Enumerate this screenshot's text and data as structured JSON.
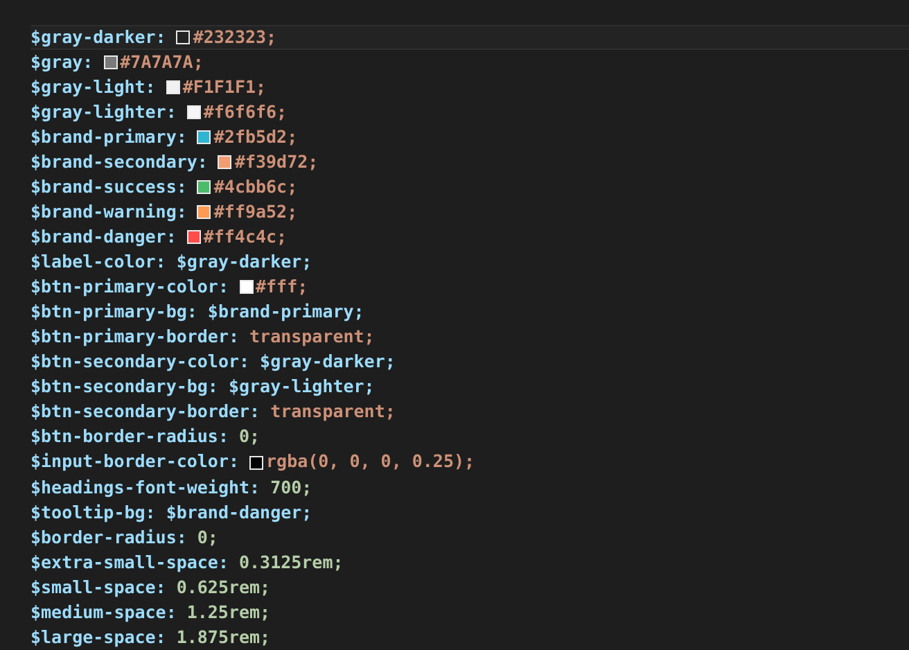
{
  "lines": [
    {
      "name": "$gray-darker:",
      "value": "#232323;",
      "kind": "color",
      "color": "#232323",
      "current": true
    },
    {
      "name": "$gray:",
      "value": "#7A7A7A;",
      "kind": "color",
      "color": "#7a7a7a",
      "current": false
    },
    {
      "name": "$gray-light:",
      "value": "#F1F1F1;",
      "kind": "color",
      "color": "#f1f1f1",
      "current": false
    },
    {
      "name": "$gray-lighter:",
      "value": "#f6f6f6;",
      "kind": "color",
      "color": "#f6f6f6",
      "current": false
    },
    {
      "name": "$brand-primary:",
      "value": "#2fb5d2;",
      "kind": "color",
      "color": "#2fb5d2",
      "current": false
    },
    {
      "name": "$brand-secondary:",
      "value": "#f39d72;",
      "kind": "color",
      "color": "#f39d72",
      "current": false
    },
    {
      "name": "$brand-success:",
      "value": "#4cbb6c;",
      "kind": "color",
      "color": "#4cbb6c",
      "current": false
    },
    {
      "name": "$brand-warning:",
      "value": "#ff9a52;",
      "kind": "color",
      "color": "#ff9a52",
      "current": false
    },
    {
      "name": "$brand-danger:",
      "value": "#ff4c4c;",
      "kind": "color",
      "color": "#ff4c4c",
      "current": false
    },
    {
      "name": "$label-color:",
      "value": "$gray-darker;",
      "kind": "variable",
      "current": false
    },
    {
      "name": "$btn-primary-color:",
      "value": "#fff;",
      "kind": "color",
      "color": "#ffffff",
      "current": false
    },
    {
      "name": "$btn-primary-bg:",
      "value": "$brand-primary;",
      "kind": "variable",
      "current": false
    },
    {
      "name": "$btn-primary-border:",
      "value": "transparent;",
      "kind": "keyword",
      "current": false
    },
    {
      "name": "$btn-secondary-color:",
      "value": "$gray-darker;",
      "kind": "variable",
      "current": false
    },
    {
      "name": "$btn-secondary-bg:",
      "value": "$gray-lighter;",
      "kind": "variable",
      "current": false
    },
    {
      "name": "$btn-secondary-border:",
      "value": "transparent;",
      "kind": "keyword",
      "current": false
    },
    {
      "name": "$btn-border-radius:",
      "value": "0;",
      "kind": "number",
      "current": false
    },
    {
      "name": "$input-border-color:",
      "value": "rgba(0, 0, 0, 0.25);",
      "kind": "color",
      "color": "#000000",
      "current": false
    },
    {
      "name": "$headings-font-weight:",
      "value": "700;",
      "kind": "number",
      "current": false
    },
    {
      "name": "$tooltip-bg:",
      "value": "$brand-danger;",
      "kind": "variable",
      "current": false
    },
    {
      "name": "$border-radius:",
      "value": "0;",
      "kind": "number",
      "current": false
    },
    {
      "name": "$extra-small-space:",
      "value": "0.3125rem;",
      "kind": "number",
      "current": false
    },
    {
      "name": "$small-space:",
      "value": "0.625rem;",
      "kind": "number",
      "current": false
    },
    {
      "name": "$medium-space:",
      "value": "1.25rem;",
      "kind": "number",
      "current": false
    },
    {
      "name": "$large-space:",
      "value": "1.875rem;",
      "kind": "number",
      "current": false
    }
  ]
}
